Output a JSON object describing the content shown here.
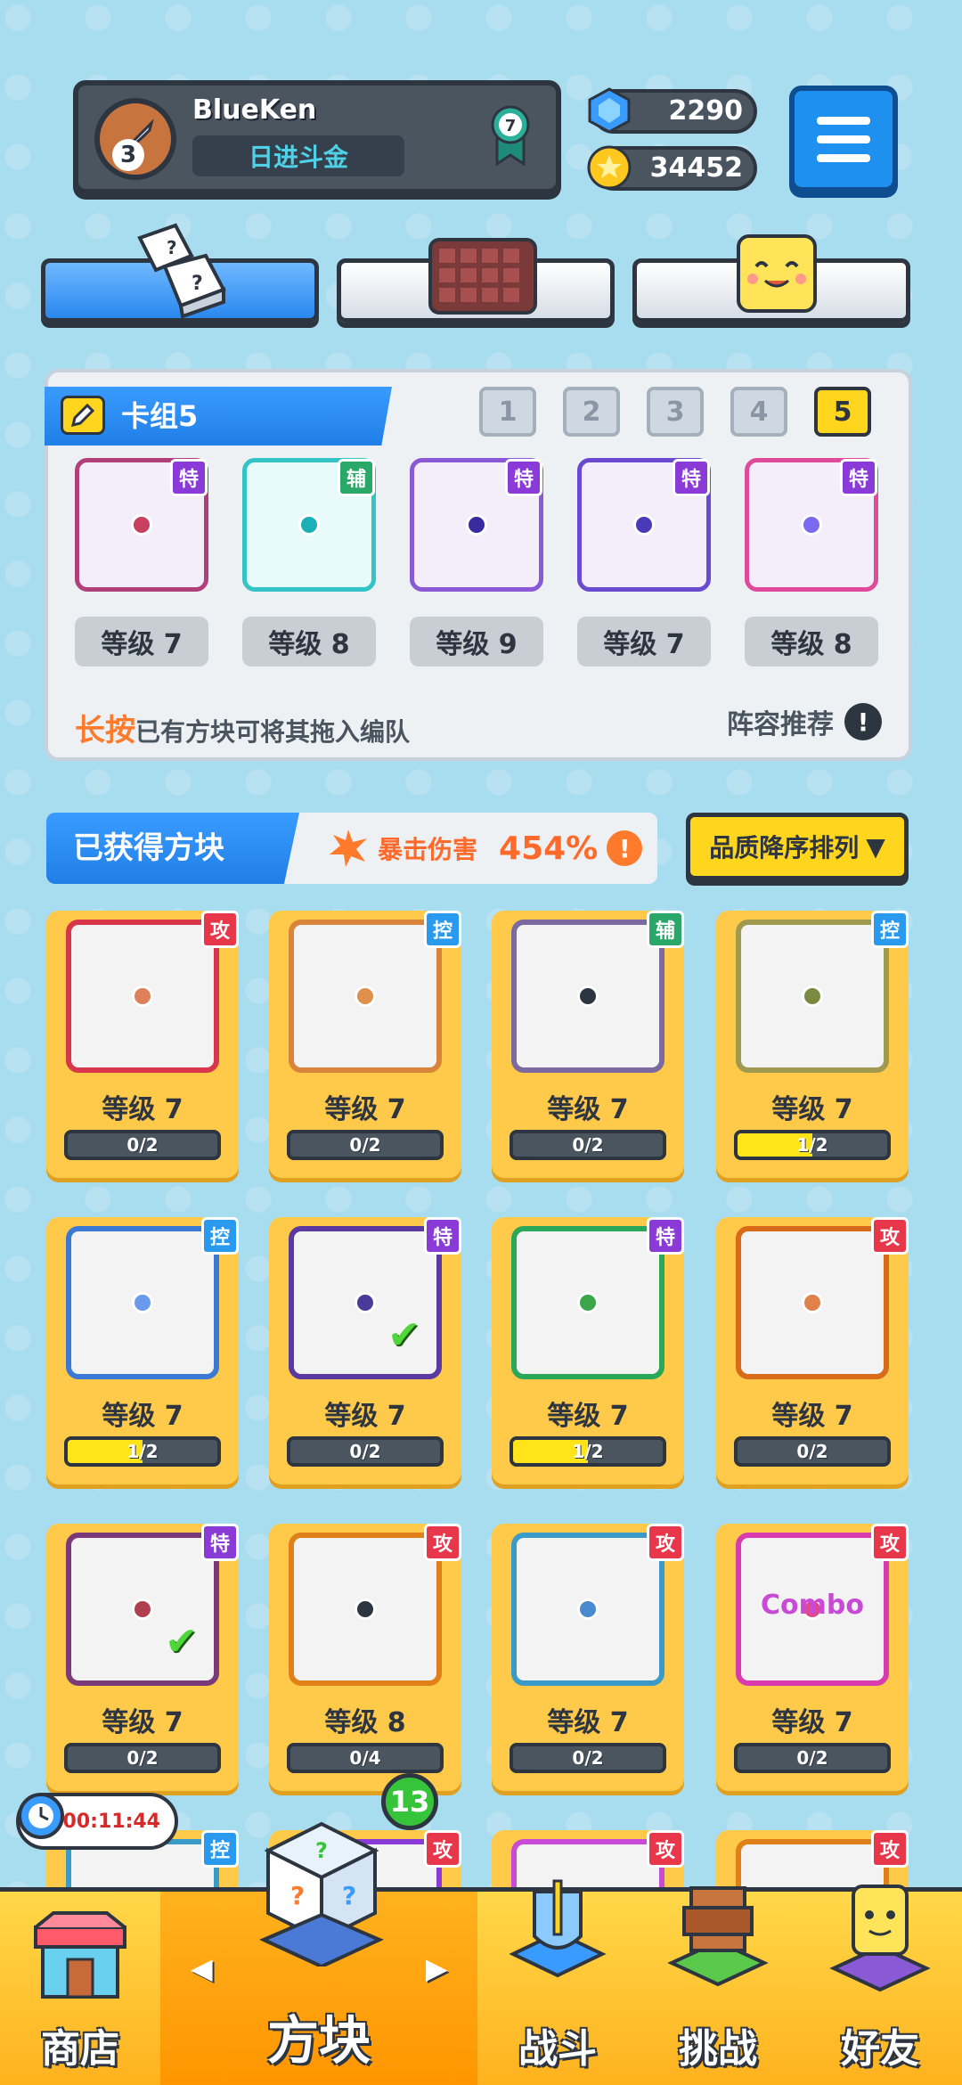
{
  "player": {
    "name": "BlueKen",
    "level": "3",
    "title": "日进斗金",
    "rank": "7"
  },
  "currency": {
    "gems": "2290",
    "coins": "34452"
  },
  "deck": {
    "title": "卡组5",
    "numbers": [
      "1",
      "2",
      "3",
      "4",
      "5"
    ],
    "active": "5",
    "cards": [
      {
        "badge": "特",
        "level": "等级 7",
        "color": "#b0407a",
        "badge_color": "#8a3ad6",
        "dot": "#c84060"
      },
      {
        "badge": "辅",
        "level": "等级 8",
        "color": "#34c4c8",
        "badge_color": "#2aa86a",
        "dot": "#1ab0b8"
      },
      {
        "badge": "特",
        "level": "等级 9",
        "color": "#8a5ad6",
        "badge_color": "#8a3ad6",
        "dot": "#3a2aa0"
      },
      {
        "badge": "特",
        "level": "等级 7",
        "color": "#6a4ad0",
        "badge_color": "#8a3ad6",
        "dot": "#4a3ab8"
      },
      {
        "badge": "特",
        "level": "等级 8",
        "color": "#e04a9a",
        "badge_color": "#8a3ad6",
        "dot": "#7a6af0"
      }
    ],
    "hint_highlight": "长按",
    "hint_rest": "已有方块可将其拖入编队",
    "lineup_recommend": "阵容推荐",
    "excl": "!"
  },
  "obtained": {
    "title": "已获得方块",
    "crit_label": "暴击伤害",
    "crit_value": "454%",
    "excl": "!",
    "sort_label": "品质降序排列",
    "sort_caret": "▼"
  },
  "cards": [
    {
      "badge": "攻",
      "badge_color": "#e8364a",
      "border": "#d8364a",
      "dot": "#e0805a",
      "level": "等级 7",
      "progress": "0/2",
      "fill": 0,
      "check": false
    },
    {
      "badge": "控",
      "badge_color": "#2a9aee",
      "border": "#d8843a",
      "dot": "#e0904a",
      "level": "等级 7",
      "progress": "0/2",
      "fill": 0,
      "check": false
    },
    {
      "badge": "辅",
      "badge_color": "#2aa86a",
      "border": "#7a6aa0",
      "dot": "#2d3540",
      "level": "等级 7",
      "progress": "0/2",
      "fill": 0,
      "check": false
    },
    {
      "badge": "控",
      "badge_color": "#2a9aee",
      "border": "#a09a50",
      "dot": "#7a8a40",
      "level": "等级 7",
      "progress": "1/2",
      "fill": 0.5,
      "check": false
    },
    {
      "badge": "控",
      "badge_color": "#2a9aee",
      "border": "#3a7ad6",
      "dot": "#6a9aee",
      "level": "等级 7",
      "progress": "1/2",
      "fill": 0.5,
      "check": false
    },
    {
      "badge": "特",
      "badge_color": "#8a3ad6",
      "border": "#5a3aa0",
      "dot": "#4a3a9a",
      "level": "等级 7",
      "progress": "0/2",
      "fill": 0,
      "check": true
    },
    {
      "badge": "特",
      "badge_color": "#8a3ad6",
      "border": "#2aa85a",
      "dot": "#3aa84a",
      "level": "等级 7",
      "progress": "1/2",
      "fill": 0.5,
      "check": false
    },
    {
      "badge": "攻",
      "badge_color": "#e8364a",
      "border": "#d86a1a",
      "dot": "#e0804a",
      "level": "等级 7",
      "progress": "0/2",
      "fill": 0,
      "check": false
    },
    {
      "badge": "特",
      "badge_color": "#8a3ad6",
      "border": "#7a3a7a",
      "dot": "#b04050",
      "level": "等级 7",
      "progress": "0/2",
      "fill": 0,
      "check": true
    },
    {
      "badge": "攻",
      "badge_color": "#e8364a",
      "border": "#e0801a",
      "dot": "#2d3540",
      "level": "等级 8",
      "progress": "0/4",
      "fill": 0,
      "check": false
    },
    {
      "badge": "攻",
      "badge_color": "#e8364a",
      "border": "#3a9ac8",
      "dot": "#4a8ad0",
      "level": "等级 7",
      "progress": "0/2",
      "fill": 0,
      "check": false
    },
    {
      "badge": "攻",
      "badge_color": "#e8364a",
      "border": "#d83ab0",
      "dot": "#e04a8a",
      "level": "等级 7",
      "progress": "0/2",
      "fill": 0,
      "check": false,
      "text": "Combo"
    }
  ],
  "partial_badges": [
    "控",
    "攻",
    "攻",
    "攻"
  ],
  "timer": "00:11:44",
  "notification_count": "13",
  "nav": {
    "shop": "商店",
    "blocks": "方块",
    "battle": "战斗",
    "challenge": "挑战",
    "friends": "好友",
    "left_arrow": "◀",
    "right_arrow": "▶"
  }
}
